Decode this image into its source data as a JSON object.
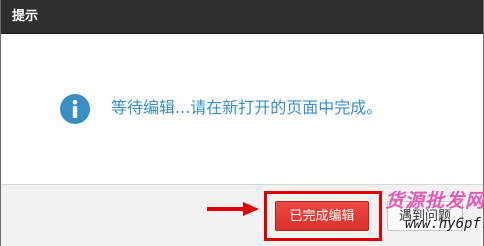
{
  "dialog": {
    "title": "提示",
    "message": "等待编辑...请在新打开的页面中完成。",
    "info_icon": "info-circle-icon"
  },
  "buttons": {
    "done_label": "已完成编辑",
    "problem_label": "遇到问题"
  },
  "watermark": {
    "line1": "货源批发网",
    "line2": "www.hy6pf.cn"
  },
  "annotations": {
    "arrow_icon": "arrow-right-icon",
    "highlight_color": "#e00000"
  },
  "colors": {
    "titlebar": "#2f2f2f",
    "message_text": "#3a8ec6",
    "primary_button": "#e0403b",
    "watermark_pink": "#e44bb0"
  }
}
